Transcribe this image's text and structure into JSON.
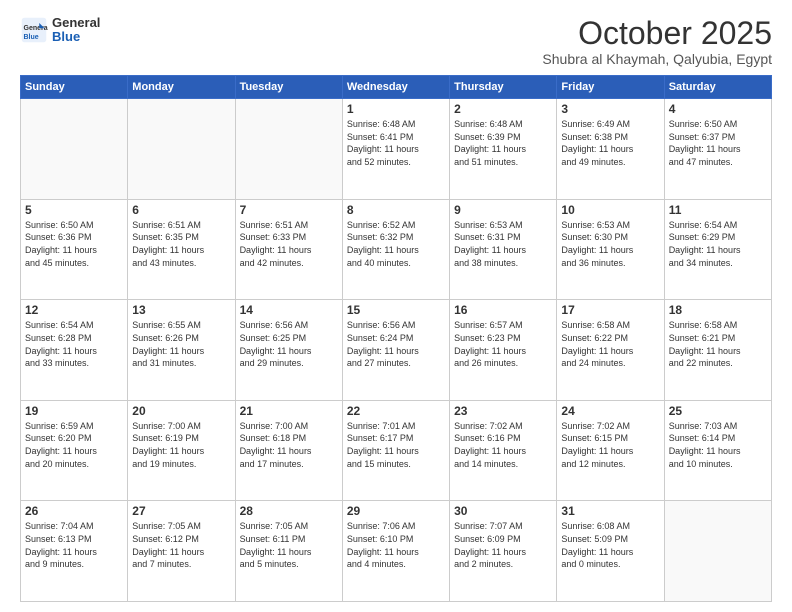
{
  "header": {
    "logo_line1": "General",
    "logo_line2": "Blue",
    "month": "October 2025",
    "location": "Shubra al Khaymah, Qalyubia, Egypt"
  },
  "weekdays": [
    "Sunday",
    "Monday",
    "Tuesday",
    "Wednesday",
    "Thursday",
    "Friday",
    "Saturday"
  ],
  "weeks": [
    [
      {
        "day": "",
        "info": ""
      },
      {
        "day": "",
        "info": ""
      },
      {
        "day": "",
        "info": ""
      },
      {
        "day": "1",
        "info": "Sunrise: 6:48 AM\nSunset: 6:41 PM\nDaylight: 11 hours\nand 52 minutes."
      },
      {
        "day": "2",
        "info": "Sunrise: 6:48 AM\nSunset: 6:39 PM\nDaylight: 11 hours\nand 51 minutes."
      },
      {
        "day": "3",
        "info": "Sunrise: 6:49 AM\nSunset: 6:38 PM\nDaylight: 11 hours\nand 49 minutes."
      },
      {
        "day": "4",
        "info": "Sunrise: 6:50 AM\nSunset: 6:37 PM\nDaylight: 11 hours\nand 47 minutes."
      }
    ],
    [
      {
        "day": "5",
        "info": "Sunrise: 6:50 AM\nSunset: 6:36 PM\nDaylight: 11 hours\nand 45 minutes."
      },
      {
        "day": "6",
        "info": "Sunrise: 6:51 AM\nSunset: 6:35 PM\nDaylight: 11 hours\nand 43 minutes."
      },
      {
        "day": "7",
        "info": "Sunrise: 6:51 AM\nSunset: 6:33 PM\nDaylight: 11 hours\nand 42 minutes."
      },
      {
        "day": "8",
        "info": "Sunrise: 6:52 AM\nSunset: 6:32 PM\nDaylight: 11 hours\nand 40 minutes."
      },
      {
        "day": "9",
        "info": "Sunrise: 6:53 AM\nSunset: 6:31 PM\nDaylight: 11 hours\nand 38 minutes."
      },
      {
        "day": "10",
        "info": "Sunrise: 6:53 AM\nSunset: 6:30 PM\nDaylight: 11 hours\nand 36 minutes."
      },
      {
        "day": "11",
        "info": "Sunrise: 6:54 AM\nSunset: 6:29 PM\nDaylight: 11 hours\nand 34 minutes."
      }
    ],
    [
      {
        "day": "12",
        "info": "Sunrise: 6:54 AM\nSunset: 6:28 PM\nDaylight: 11 hours\nand 33 minutes."
      },
      {
        "day": "13",
        "info": "Sunrise: 6:55 AM\nSunset: 6:26 PM\nDaylight: 11 hours\nand 31 minutes."
      },
      {
        "day": "14",
        "info": "Sunrise: 6:56 AM\nSunset: 6:25 PM\nDaylight: 11 hours\nand 29 minutes."
      },
      {
        "day": "15",
        "info": "Sunrise: 6:56 AM\nSunset: 6:24 PM\nDaylight: 11 hours\nand 27 minutes."
      },
      {
        "day": "16",
        "info": "Sunrise: 6:57 AM\nSunset: 6:23 PM\nDaylight: 11 hours\nand 26 minutes."
      },
      {
        "day": "17",
        "info": "Sunrise: 6:58 AM\nSunset: 6:22 PM\nDaylight: 11 hours\nand 24 minutes."
      },
      {
        "day": "18",
        "info": "Sunrise: 6:58 AM\nSunset: 6:21 PM\nDaylight: 11 hours\nand 22 minutes."
      }
    ],
    [
      {
        "day": "19",
        "info": "Sunrise: 6:59 AM\nSunset: 6:20 PM\nDaylight: 11 hours\nand 20 minutes."
      },
      {
        "day": "20",
        "info": "Sunrise: 7:00 AM\nSunset: 6:19 PM\nDaylight: 11 hours\nand 19 minutes."
      },
      {
        "day": "21",
        "info": "Sunrise: 7:00 AM\nSunset: 6:18 PM\nDaylight: 11 hours\nand 17 minutes."
      },
      {
        "day": "22",
        "info": "Sunrise: 7:01 AM\nSunset: 6:17 PM\nDaylight: 11 hours\nand 15 minutes."
      },
      {
        "day": "23",
        "info": "Sunrise: 7:02 AM\nSunset: 6:16 PM\nDaylight: 11 hours\nand 14 minutes."
      },
      {
        "day": "24",
        "info": "Sunrise: 7:02 AM\nSunset: 6:15 PM\nDaylight: 11 hours\nand 12 minutes."
      },
      {
        "day": "25",
        "info": "Sunrise: 7:03 AM\nSunset: 6:14 PM\nDaylight: 11 hours\nand 10 minutes."
      }
    ],
    [
      {
        "day": "26",
        "info": "Sunrise: 7:04 AM\nSunset: 6:13 PM\nDaylight: 11 hours\nand 9 minutes."
      },
      {
        "day": "27",
        "info": "Sunrise: 7:05 AM\nSunset: 6:12 PM\nDaylight: 11 hours\nand 7 minutes."
      },
      {
        "day": "28",
        "info": "Sunrise: 7:05 AM\nSunset: 6:11 PM\nDaylight: 11 hours\nand 5 minutes."
      },
      {
        "day": "29",
        "info": "Sunrise: 7:06 AM\nSunset: 6:10 PM\nDaylight: 11 hours\nand 4 minutes."
      },
      {
        "day": "30",
        "info": "Sunrise: 7:07 AM\nSunset: 6:09 PM\nDaylight: 11 hours\nand 2 minutes."
      },
      {
        "day": "31",
        "info": "Sunrise: 6:08 AM\nSunset: 5:09 PM\nDaylight: 11 hours\nand 0 minutes."
      },
      {
        "day": "",
        "info": ""
      }
    ]
  ]
}
